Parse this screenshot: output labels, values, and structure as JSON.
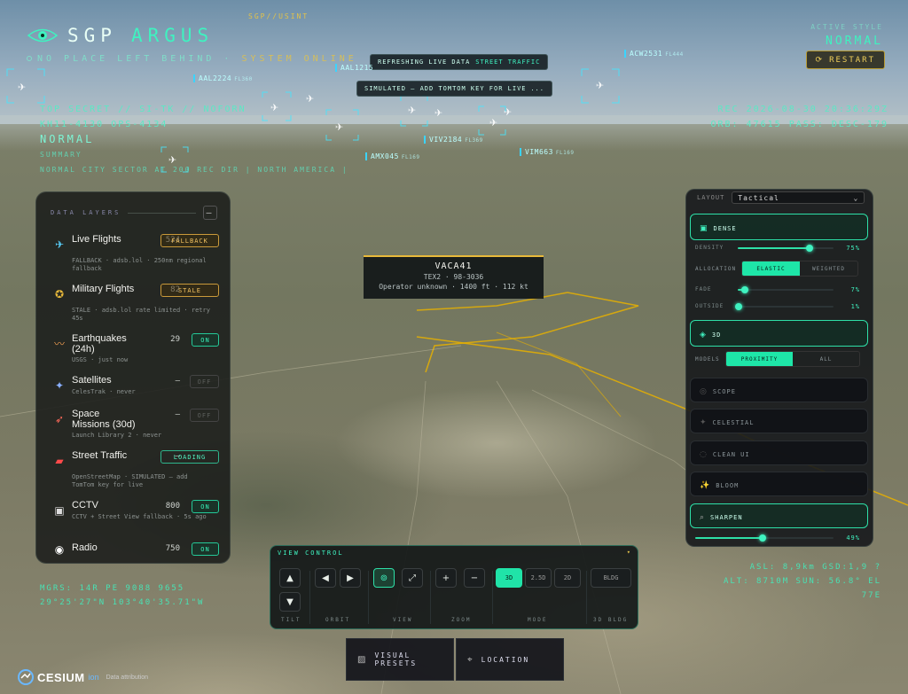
{
  "header": {
    "brand_primary": "SGP",
    "brand_secondary": "ARGUS",
    "tagline": "NO PLACE LEFT BEHIND ·",
    "system_status": "SYSTEM ONLINE",
    "classification_tag": "SGP//USINT",
    "hud_left": {
      "line1": "TOP SECRET // SI-TK // NOFORN",
      "line2": "KH11-4130 OPS-4134",
      "mode": "NORMAL",
      "line4": "SUMMARY",
      "line5": "NORMAL CITY SECTOR AT 200 REC DIR | NORTH AMERICA |"
    },
    "hud_right": {
      "line1": "REC 2026-08-30 20:36:29Z",
      "line2": "ORB: 47615 PASS: DESC-179"
    },
    "active_style_label": "ACTIVE STYLE",
    "active_style_value": "NORMAL",
    "restart_label": "RESTART"
  },
  "notices": {
    "refresh": "REFRESHING LIVE DATA",
    "refresh_highlight": "STREET TRAFFIC",
    "simulated": "SIMULATED — ADD TOMTOM KEY FOR LIVE",
    "simulated_suffix": "..."
  },
  "flights": [
    {
      "callsign": "ACW2531",
      "fl": "FL444"
    },
    {
      "callsign": "AAL1215",
      "fl": ""
    },
    {
      "callsign": "AAL2224",
      "fl": "FL360"
    },
    {
      "callsign": "VIV2184",
      "fl": "FL369"
    },
    {
      "callsign": "AMX045",
      "fl": "FL169"
    },
    {
      "callsign": "VIM663",
      "fl": "FL169"
    }
  ],
  "tooltip": {
    "title": "VACA41",
    "line2": "TEX2 · 98-3036",
    "line3": "Operator unknown · 1400 ft · 112 kt"
  },
  "layers": {
    "title": "DATA LAYERS",
    "collapse_label": "—",
    "items": [
      {
        "icon": "airplane-icon",
        "glyph": "✈",
        "name": "Live Flights",
        "count": "524",
        "status": "FALLBACK",
        "sub": "FALLBACK · adsb.lol · 250nm regional fallback"
      },
      {
        "icon": "military-icon",
        "glyph": "✪",
        "name": "Military Flights",
        "count": "82",
        "status": "STALE",
        "sub": "STALE · adsb.lol rate limited · retry 45s"
      },
      {
        "icon": "earthquake-icon",
        "glyph": "〰",
        "name": "Earthquakes (24h)",
        "count": "29",
        "status": "ON",
        "sub": "USGS · just now"
      },
      {
        "icon": "satellite-icon",
        "glyph": "✦",
        "name": "Satellites",
        "count": "—",
        "status": "OFF",
        "sub": "CelesTrak · never"
      },
      {
        "icon": "rocket-icon",
        "glyph": "➶",
        "name": "Space Missions (30d)",
        "count": "—",
        "status": "OFF",
        "sub": "Launch Library 2 · never"
      },
      {
        "icon": "car-icon",
        "glyph": "▰",
        "name": "Street Traffic",
        "count": "—",
        "status": "LOADING",
        "sub": "OpenStreetMap · SIMULATED — add TomTom key for live"
      },
      {
        "icon": "camera-icon",
        "glyph": "▣",
        "name": "CCTV",
        "count": "800",
        "status": "ON",
        "sub": "CCTV + Street View fallback · 5s ago"
      },
      {
        "icon": "radio-icon",
        "glyph": "◉",
        "name": "Radio",
        "count": "750",
        "status": "ON",
        "sub": ""
      }
    ]
  },
  "right_panel": {
    "layout_label": "LAYOUT",
    "layout_value": "Tactical",
    "dense_label": "DENSE",
    "density_label": "DENSITY",
    "density_value": "75%",
    "density_level": 0.75,
    "allocation_label": "ALLOCATION",
    "allocation_options": [
      "ELASTIC",
      "WEIGHTED"
    ],
    "fade_label": "FADE",
    "fade_value": "7%",
    "fade_level": 0.07,
    "outside_label": "OUTSIDE",
    "outside_value": "1%",
    "outside_level": 0.01,
    "threed_label": "3D",
    "models_label": "MODELS",
    "models_options": [
      "PROXIMITY",
      "ALL"
    ],
    "scope_label": "SCOPE",
    "celestial_label": "CELESTIAL",
    "clean_label": "CLEAN UI",
    "bloom_label": "BLOOM",
    "sharpen_label": "SHARPEN",
    "sharpen_value": "49%",
    "sharpen_level": 0.49
  },
  "view_control": {
    "title": "VIEW CONTROL",
    "caret": "▾",
    "tilt_label": "TILT",
    "orbit_label": "ORBIT",
    "view_label": "VIEW",
    "zoom_label": "ZOOM",
    "mode_label": "MODE",
    "bldg_label": "3D BLDG",
    "modes": [
      "3D",
      "2.5D",
      "2D"
    ],
    "bldg_button": "BLDG"
  },
  "bottom": {
    "visual_presets": "VISUAL PRESETS",
    "location": "LOCATION"
  },
  "hud_bottom_left": {
    "line1": "MGRS: 14R PE 9088 9655",
    "line2": "29°25'27\"N 103°40'35.71\"W"
  },
  "hud_bottom_right": {
    "line1": "ASL: 8,9km GSD:1,9 ?",
    "line2": "ALT: 8710M SUN: 56.8° EL",
    "line3": "77E"
  },
  "cesium": {
    "name": "CESIUM",
    "sub": "ion",
    "credit": "Data attribution"
  },
  "colors": {
    "accent": "#3ff2c0",
    "warning": "#e2c24a",
    "panel": "#1a1c1a"
  }
}
